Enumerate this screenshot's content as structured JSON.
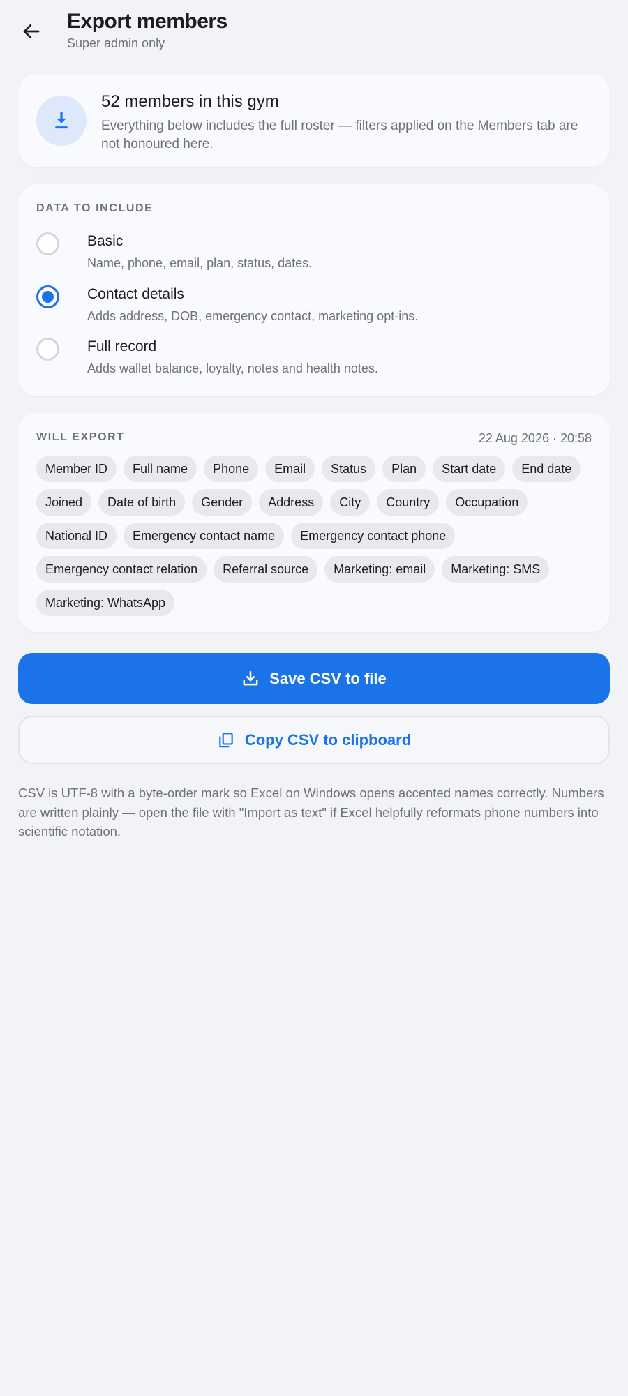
{
  "header": {
    "title": "Export members",
    "subtitle": "Super admin only",
    "back_icon": "arrow-left-icon"
  },
  "summary": {
    "icon": "download-icon",
    "title": "52 members in this gym",
    "description": "Everything below includes the full roster — filters applied on the Members tab are not honoured here."
  },
  "include": {
    "label": "DATA TO INCLUDE",
    "selected": "Contact details",
    "options": [
      {
        "title": "Basic",
        "description": "Name, phone, email, plan, status, dates."
      },
      {
        "title": "Contact details",
        "description": "Adds address, DOB, emergency contact, marketing opt-ins."
      },
      {
        "title": "Full record",
        "description": "Adds wallet balance, loyalty, notes and health notes."
      }
    ]
  },
  "export": {
    "label": "WILL EXPORT",
    "timestamp": "22 Aug 2026 · 20:58",
    "fields": [
      "Member ID",
      "Full name",
      "Phone",
      "Email",
      "Status",
      "Plan",
      "Start date",
      "End date",
      "Joined",
      "Date of birth",
      "Gender",
      "Address",
      "City",
      "Country",
      "Occupation",
      "National ID",
      "Emergency contact name",
      "Emergency contact phone",
      "Emergency contact relation",
      "Referral source",
      "Marketing: email",
      "Marketing: SMS",
      "Marketing: WhatsApp"
    ]
  },
  "actions": {
    "save_label": "Save CSV to file",
    "save_icon": "save-download-icon",
    "copy_label": "Copy CSV to clipboard",
    "copy_icon": "copy-icon"
  },
  "footnote": "CSV is UTF-8 with a byte-order mark so Excel on Windows opens accented names correctly. Numbers are written plainly — open the file with \"Import as text\" if Excel helpfully reformats phone numbers into scientific notation.",
  "colors": {
    "accent": "#1a73e8",
    "background": "#f2f3f6",
    "card": "#f9fafd",
    "chip": "#e8e9ed",
    "muted_text": "#6f7178"
  }
}
